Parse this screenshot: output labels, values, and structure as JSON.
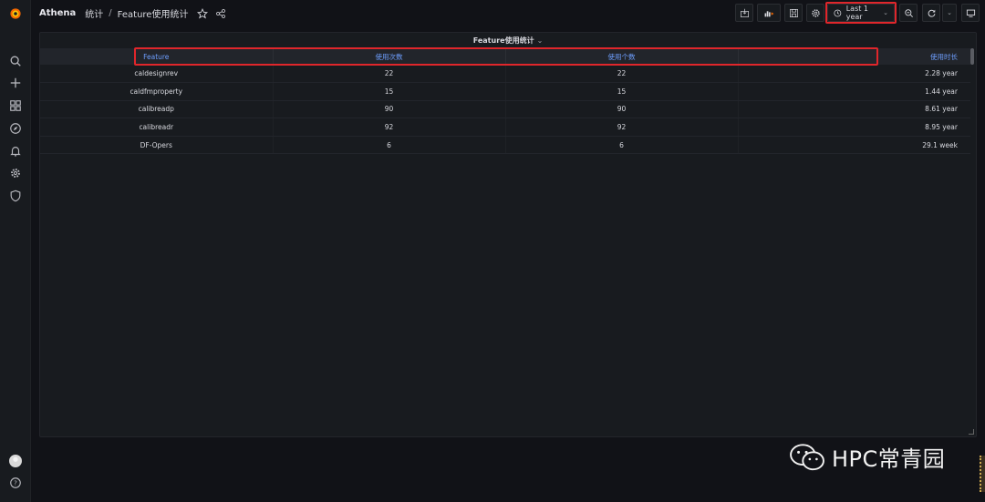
{
  "app": {
    "name": "Athena",
    "folder": "统计",
    "separator": "/",
    "dashboard_title": "Feature使用统计",
    "brand_color": "#f46800",
    "accent_color": "#6e9fff",
    "highlight_color": "#e0262b"
  },
  "sidebar": {
    "items": [
      {
        "icon": "search-icon"
      },
      {
        "icon": "plus-icon"
      },
      {
        "icon": "dashboards-grid-icon"
      },
      {
        "icon": "compass-icon"
      },
      {
        "icon": "bell-icon"
      },
      {
        "icon": "gear-icon"
      },
      {
        "icon": "shield-icon"
      }
    ],
    "bottom": [
      {
        "icon": "avatar"
      },
      {
        "icon": "help-icon"
      }
    ]
  },
  "toolbar": {
    "time_range": "Last 1 year",
    "buttons": [
      "add-panel-icon",
      "save-icon",
      "settings-icon",
      "zoom-out-icon",
      "refresh-icon",
      "tv-mode-icon"
    ]
  },
  "panel": {
    "title": "Feature使用统计",
    "columns": [
      "Feature",
      "使用次数",
      "使用个数",
      "使用时长"
    ],
    "rows": [
      [
        "caldesignrev",
        "22",
        "22",
        "2.28 year"
      ],
      [
        "caldfmproperty",
        "15",
        "15",
        "1.44 year"
      ],
      [
        "calibreadp",
        "90",
        "90",
        "8.61 year"
      ],
      [
        "calibreadr",
        "92",
        "92",
        "8.95 year"
      ],
      [
        "DF-Opers",
        "6",
        "6",
        "29.1 week"
      ]
    ]
  },
  "watermark": {
    "text": "HPC常青园"
  }
}
